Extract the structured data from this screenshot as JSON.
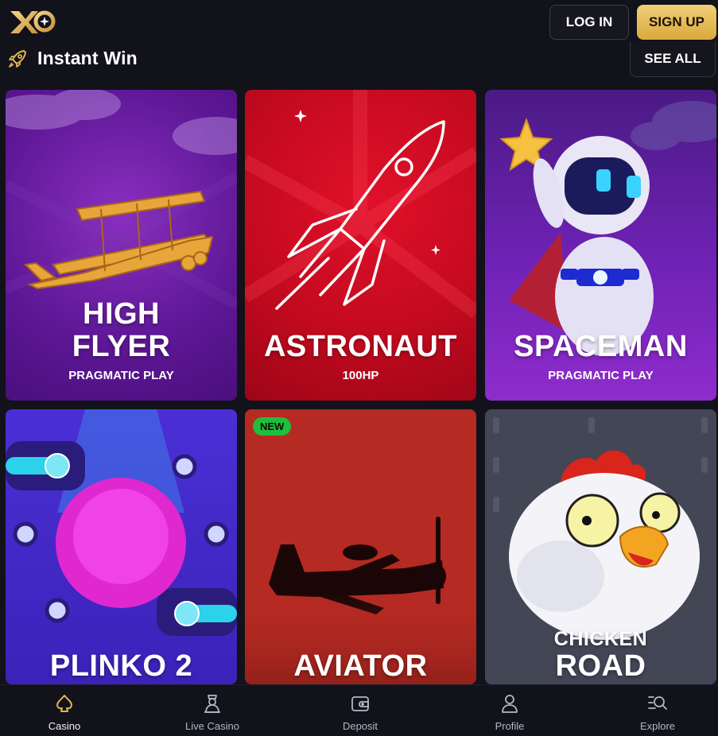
{
  "header": {
    "logo_text": "XO",
    "login_label": "LOG IN",
    "signup_label": "SIGN UP"
  },
  "section": {
    "icon": "rocket-icon",
    "title": "Instant Win",
    "see_all_label": "SEE ALL"
  },
  "games": [
    {
      "title_line1": "HIGH",
      "title_line2": "FLYER",
      "provider": "PRAGMATIC PLAY",
      "badge": ""
    },
    {
      "title_line1": "",
      "title_line2": "ASTRONAUT",
      "provider": "100HP",
      "badge": ""
    },
    {
      "title_line1": "",
      "title_line2": "SPACEMAN",
      "provider": "PRAGMATIC PLAY",
      "badge": ""
    },
    {
      "title_line1": "",
      "title_line2": "PLINKO 2",
      "provider": "",
      "badge": ""
    },
    {
      "title_line1": "",
      "title_line2": "AVIATOR",
      "provider": "",
      "badge": "NEW"
    },
    {
      "title_line1": "CHICKEN",
      "title_line2": "ROAD",
      "provider": "",
      "badge": ""
    }
  ],
  "bottom_nav": [
    {
      "label": "Casino",
      "icon": "spade-icon",
      "active": true
    },
    {
      "label": "Live Casino",
      "icon": "dealer-icon",
      "active": false
    },
    {
      "label": "Deposit",
      "icon": "wallet-icon",
      "active": false
    },
    {
      "label": "Profile",
      "icon": "profile-icon",
      "active": false
    },
    {
      "label": "Explore",
      "icon": "explore-icon",
      "active": false
    }
  ],
  "colors": {
    "background": "#12121b",
    "accent_gold": "#e2b450",
    "badge_green": "#1fbf3b"
  }
}
